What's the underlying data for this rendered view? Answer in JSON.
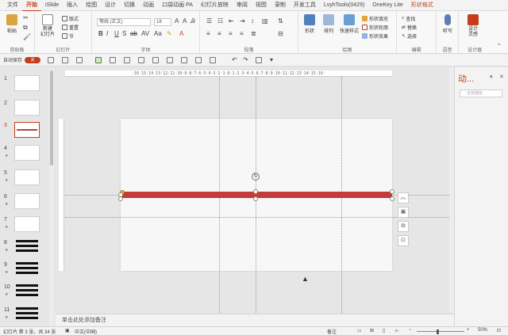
{
  "tabs": [
    "文件",
    "开始",
    "iSlide",
    "插入",
    "绘图",
    "设计",
    "切换",
    "动画",
    "口袋动画 PA",
    "幻灯片放映",
    "审阅",
    "视图",
    "录制",
    "开发工具",
    "LvyhTools(0429)",
    "OneKey Lite",
    "形状格式"
  ],
  "active_tab": "开始",
  "context_tab": "形状格式",
  "ribbon": {
    "clipboard": {
      "paste": "粘贴",
      "label": "剪贴板"
    },
    "slides": {
      "new_slide": "新建\n幻灯片",
      "layout": "版式",
      "reset": "重置",
      "section": "节",
      "label": "幻灯片"
    },
    "font": {
      "font_name": "等线 (正文)",
      "font_size": "18",
      "label": "字体"
    },
    "paragraph": {
      "label": "段落"
    },
    "drawing": {
      "shape": "形状",
      "arrange": "排列",
      "quick_styles": "快速样式",
      "fill": "形状填充",
      "outline": "形状轮廓",
      "effects": "形状效果",
      "label": "绘图"
    },
    "editing": {
      "find": "查找",
      "replace": "替换",
      "select": "选择",
      "label": "编辑"
    },
    "voice": {
      "dictate": "听写",
      "label": "语音"
    },
    "designer": {
      "ideas": "设计\n灵感",
      "label": "设计器"
    }
  },
  "qat": {
    "autosave_label": "自动保存",
    "autosave_state": "关"
  },
  "ruler_text": "·16·15·14·13·12·11·10·9·8·7·6·5·4·3·2·1·0·1·2·3·4·5·6·7·8·9·10·11·12·13·14·15·16·",
  "thumbnails": [
    "1",
    "2",
    "3",
    "4",
    "5",
    "6",
    "7",
    "8",
    "9",
    "10",
    "11"
  ],
  "selected_slide": "3",
  "notes_placeholder": "单击此处添加备注",
  "animation_pane": {
    "title": "动...",
    "play_all": "全部播放",
    "pin": "▾",
    "close": "✕"
  },
  "status": {
    "slide_info": "幻灯片 第 3 张，共 34 张",
    "language": "中文(中国)",
    "notes": "备注",
    "zoom": "50%"
  },
  "colors": {
    "accent": "#c43e1c",
    "shape_fill": "#c33b3b"
  }
}
